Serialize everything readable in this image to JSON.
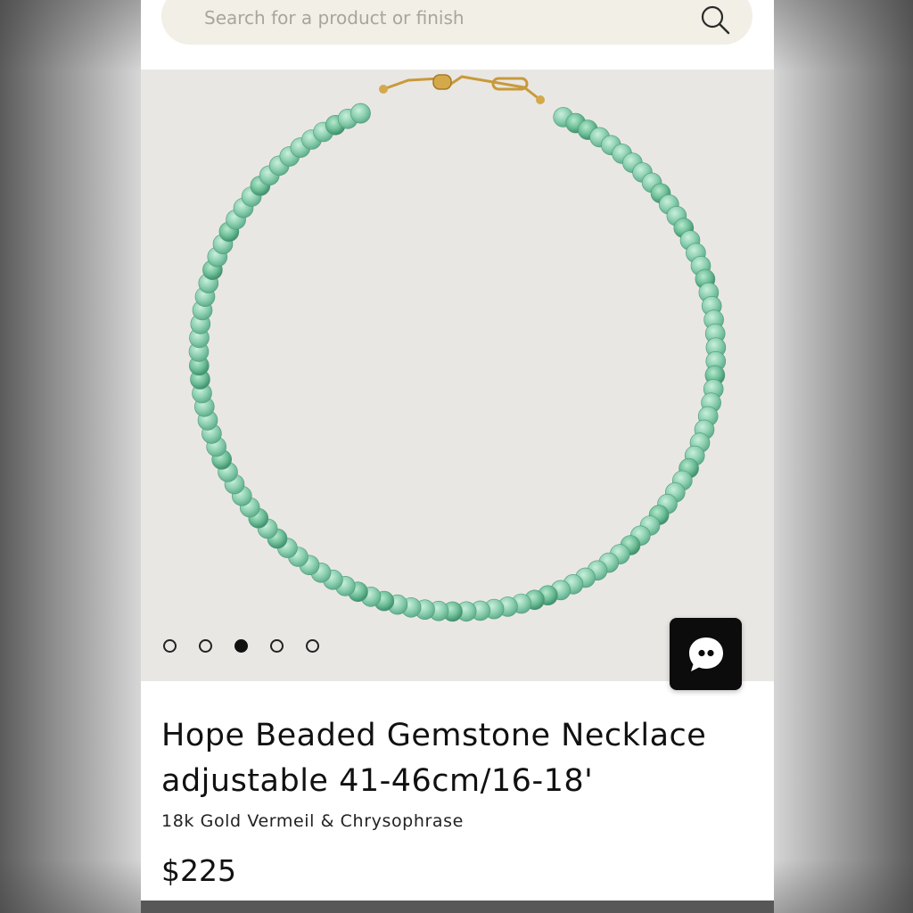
{
  "search": {
    "placeholder": "Search for a product or finish"
  },
  "icons": {
    "search": "search-icon",
    "chat": "chat-bubble-icon"
  },
  "product": {
    "title": "Hope Beaded Gemstone Necklace adjustable 41-46cm/16-18'",
    "subtitle": "18k Gold Vermeil & Chrysophrase",
    "price": "$225"
  },
  "carousel": {
    "total": 5,
    "active_index": 3
  },
  "colors": {
    "bead": "#8fd1b2",
    "clasp": "#d4a94a",
    "chat_button": "#0c0c0c",
    "search_bg": "#f1efe6"
  }
}
